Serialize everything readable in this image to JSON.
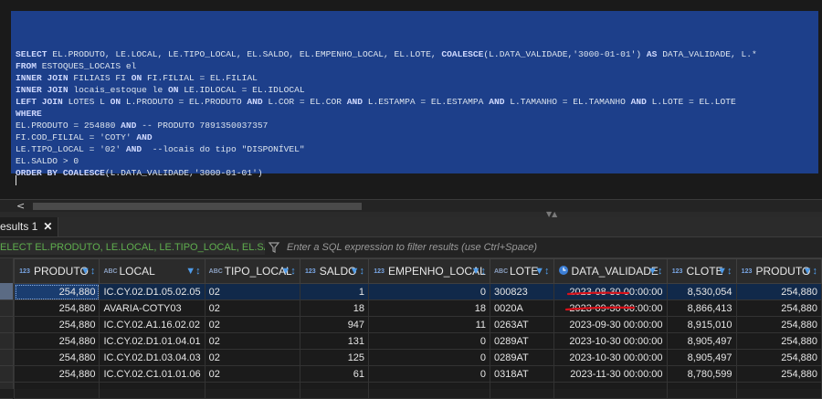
{
  "editor": {
    "lines": [
      [
        {
          "t": "SELECT ",
          "k": 1
        },
        {
          "t": "EL.PRODUTO, LE.LOCAL, LE.TIPO_LOCAL, EL.SALDO, EL.EMPENHO_LOCAL, EL.LOTE, "
        },
        {
          "t": "COALESCE",
          "k": 1
        },
        {
          "t": "(L.DATA_VALIDADE,'3000-01-01') "
        },
        {
          "t": "AS ",
          "k": 1
        },
        {
          "t": "DATA_VALIDADE, L.*"
        }
      ],
      [
        {
          "t": "FROM ",
          "k": 1
        },
        {
          "t": "ESTOQUES_LOCAIS el"
        }
      ],
      [
        {
          "t": "INNER JOIN ",
          "k": 1
        },
        {
          "t": "FILIAIS FI "
        },
        {
          "t": "ON ",
          "k": 1
        },
        {
          "t": "FI.FILIAL = EL.FILIAL"
        }
      ],
      [
        {
          "t": "INNER JOIN ",
          "k": 1
        },
        {
          "t": "locais_estoque le "
        },
        {
          "t": "ON ",
          "k": 1
        },
        {
          "t": "LE.IDLOCAL = EL.IDLOCAL"
        }
      ],
      [
        {
          "t": "LEFT JOIN ",
          "k": 1
        },
        {
          "t": "LOTES L "
        },
        {
          "t": "ON ",
          "k": 1
        },
        {
          "t": "L.PRODUTO = EL.PRODUTO "
        },
        {
          "t": "AND ",
          "k": 1
        },
        {
          "t": "L.COR = EL.COR "
        },
        {
          "t": "AND ",
          "k": 1
        },
        {
          "t": "L.ESTAMPA = EL.ESTAMPA "
        },
        {
          "t": "AND ",
          "k": 1
        },
        {
          "t": "L.TAMANHO = EL.TAMANHO "
        },
        {
          "t": "AND ",
          "k": 1
        },
        {
          "t": "L.LOTE = EL.LOTE"
        }
      ],
      [
        {
          "t": "WHERE",
          "k": 1
        }
      ],
      [
        {
          "t": "EL.PRODUTO = 254880 "
        },
        {
          "t": "AND ",
          "k": 1
        },
        {
          "t": "-- PRODUTO 7891350037357"
        }
      ],
      [
        {
          "t": "FI.COD_FILIAL = 'COTY' "
        },
        {
          "t": "AND",
          "k": 1
        }
      ],
      [
        {
          "t": "LE.TIPO_LOCAL = '02' "
        },
        {
          "t": "AND ",
          "k": 1
        },
        {
          "t": " --locais do tipo \"DISPONÍVEL\""
        }
      ],
      [
        {
          "t": "EL.SALDO > 0"
        }
      ],
      [
        {
          "t": "ORDER BY COALESCE",
          "k": 1
        },
        {
          "t": "(L.DATA_VALIDADE,'3000-01-01')"
        }
      ]
    ]
  },
  "results_tab": {
    "label": "esults 1"
  },
  "filter": {
    "query_text": "ELECT EL.PRODUTO, LE.LOCAL, LE.TIPO_LOCAL, EL.SALDO, EL.E",
    "placeholder": "Enter a SQL expression to filter results (use Ctrl+Space)"
  },
  "grid": {
    "columns": [
      {
        "label": "PRODUTO",
        "type": "123",
        "align": "num"
      },
      {
        "label": "LOCAL",
        "type": "ABC",
        "align": "txt"
      },
      {
        "label": "TIPO_LOCAL",
        "type": "ABC",
        "align": "txt"
      },
      {
        "label": "SALDO",
        "type": "123",
        "align": "txt"
      },
      {
        "label": "EMPENHO_LOCAL",
        "type": "123",
        "align": "num"
      },
      {
        "label": "LOTE",
        "type": "ABC",
        "align": "txt"
      },
      {
        "label": "DATA_VALIDADE",
        "type": "clock",
        "align": "num"
      },
      {
        "label": "CLOTE",
        "type": "123",
        "align": "txt"
      },
      {
        "label": "PRODUTO",
        "type": "123",
        "align": "num"
      }
    ],
    "rows": [
      [
        "254,880",
        "IC.CY.02.D1.05.02.05",
        "02",
        "1",
        "0",
        "300823",
        "2023-08-30 00:00:00",
        "8,530,054",
        "254,880"
      ],
      [
        "254,880",
        "AVARIA-COTY03",
        "02",
        "18",
        "18",
        "0020A",
        "2023-09-30 00:00:00",
        "8,866,413",
        "254,880"
      ],
      [
        "254,880",
        "IC.CY.02.A1.16.02.02",
        "02",
        "947",
        "11",
        "0263AT",
        "2023-09-30 00:00:00",
        "8,915,010",
        "254,880"
      ],
      [
        "254,880",
        "IC.CY.02.D1.01.04.01",
        "02",
        "131",
        "0",
        "0289AT",
        "2023-10-30 00:00:00",
        "8,905,497",
        "254,880"
      ],
      [
        "254,880",
        "IC.CY.02.D1.03.04.03",
        "02",
        "125",
        "0",
        "0289AT",
        "2023-10-30 00:00:00",
        "8,905,497",
        "254,880"
      ],
      [
        "254,880",
        "IC.CY.02.C1.01.01.06",
        "02",
        "61",
        "0",
        "0318AT",
        "2023-11-30 00:00:00",
        "8,780,599",
        "254,880"
      ]
    ]
  }
}
